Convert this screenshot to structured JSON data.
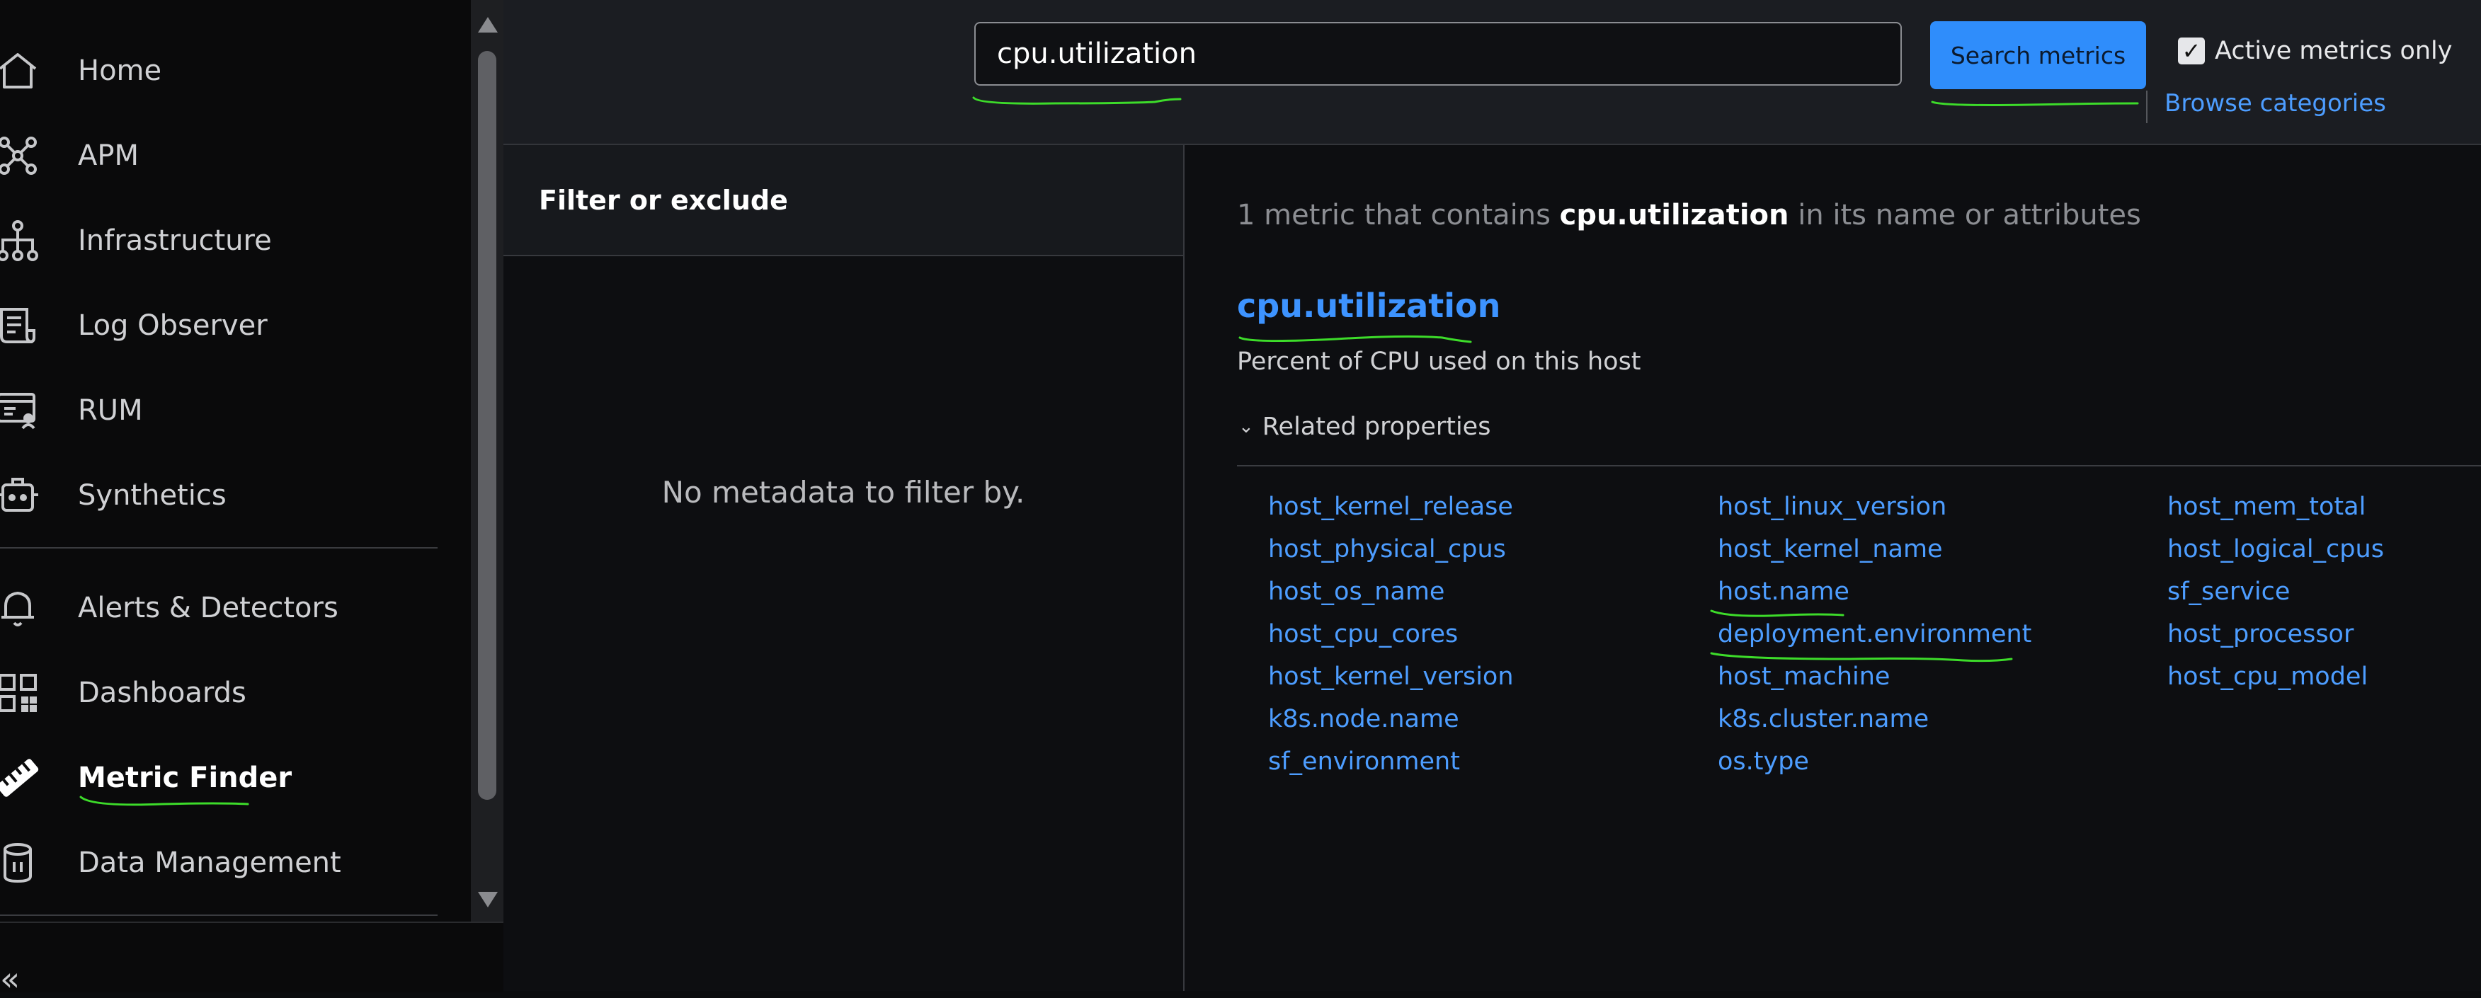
{
  "sidebar": {
    "items": [
      {
        "label": "Home",
        "icon": "home-icon"
      },
      {
        "label": "APM",
        "icon": "apm-icon"
      },
      {
        "label": "Infrastructure",
        "icon": "infrastructure-icon"
      },
      {
        "label": "Log Observer",
        "icon": "log-observer-icon"
      },
      {
        "label": "RUM",
        "icon": "rum-icon"
      },
      {
        "label": "Synthetics",
        "icon": "synthetics-icon"
      },
      {
        "label": "Alerts & Detectors",
        "icon": "bell-icon"
      },
      {
        "label": "Dashboards",
        "icon": "dashboards-icon"
      },
      {
        "label": "Metric Finder",
        "icon": "ruler-icon"
      },
      {
        "label": "Data Management",
        "icon": "database-icon"
      }
    ],
    "active": "Metric Finder",
    "collapse_label": "«"
  },
  "search": {
    "value": "cpu.utilization",
    "button_label": "Search metrics",
    "active_only_label": "Active metrics only",
    "active_only_checked": true,
    "browse_label": "Browse categories"
  },
  "filter": {
    "title": "Filter or exclude",
    "empty_text": "No metadata to filter by."
  },
  "results": {
    "summary_count": "1 metric that contains",
    "summary_term": "cpu.utilization",
    "summary_suffix": "in its name or attributes",
    "metric": {
      "name": "cpu.utilization",
      "description": "Percent of CPU used on this host"
    },
    "related_label": "Related properties",
    "related_properties": [
      [
        "host_kernel_release",
        "host_physical_cpus",
        "host_os_name",
        "host_cpu_cores",
        "host_kernel_version",
        "k8s.node.name",
        "sf_environment"
      ],
      [
        "host_linux_version",
        "host_kernel_name",
        "host.name",
        "deployment.environment",
        "host_machine",
        "k8s.cluster.name",
        "os.type"
      ],
      [
        "host_mem_total",
        "host_logical_cpus",
        "sf_service",
        "host_processor",
        "host_cpu_model"
      ]
    ]
  },
  "colors": {
    "accent": "#2f8dfb",
    "link": "#4d9dff",
    "annotation": "#3ddc2a"
  }
}
